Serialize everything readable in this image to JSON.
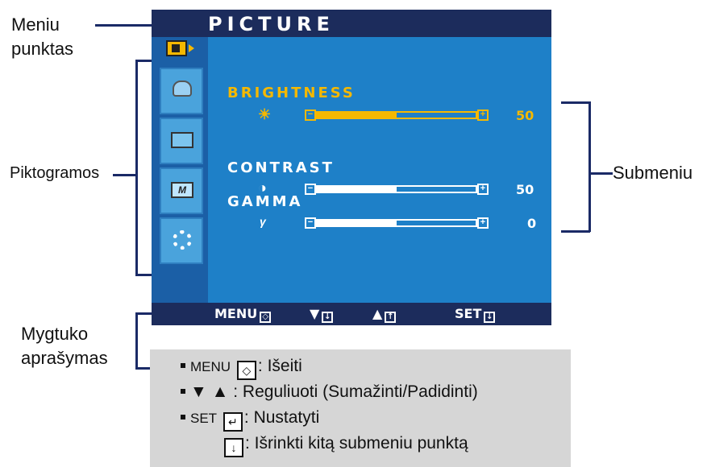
{
  "callouts": {
    "menu_item_line1": "Meniu",
    "menu_item_line2": "punktas",
    "icons": "Piktogramos",
    "submenu": "Submeniu",
    "button_desc_line1": "Mygtuko",
    "button_desc_line2": "aprašymas"
  },
  "osd": {
    "title": "PICTURE",
    "submenu": [
      {
        "label": "BRIGHTNESS",
        "icon": "sun-icon",
        "icon_glyph": "☀",
        "value": "50",
        "level": 0.5,
        "active": true
      },
      {
        "label": "CONTRAST",
        "icon": "contrast-icon",
        "icon_glyph": "◑",
        "value": "50",
        "level": 0.5,
        "active": false
      },
      {
        "label": "GAMMA",
        "icon": "gamma-icon",
        "icon_glyph": "γ",
        "value": "0",
        "level": 0.5,
        "active": false
      }
    ],
    "footer": {
      "menu_label": "MENU",
      "down_label": "▼",
      "up_label": "▲",
      "set_label": "SET"
    },
    "icons": [
      "picture-icon",
      "monitor-icon",
      "screen-icon",
      "color-icon",
      "settings-icon"
    ]
  },
  "legend": {
    "row1_key": "MENU",
    "row1_text": ": Išeiti",
    "row2_key": "▼ ▲",
    "row2_text": ": Reguliuoti (Sumažinti/Padidinti)",
    "row3_key": "SET",
    "row3_text": ": Nustatyti",
    "row4_text": ": Išrinkti kitą submeniu punktą"
  },
  "colors": {
    "osd_body": "#1e80c8",
    "osd_bar": "#1c2c5c",
    "active_text": "#f5b800",
    "normal_text": "#ffffff"
  }
}
